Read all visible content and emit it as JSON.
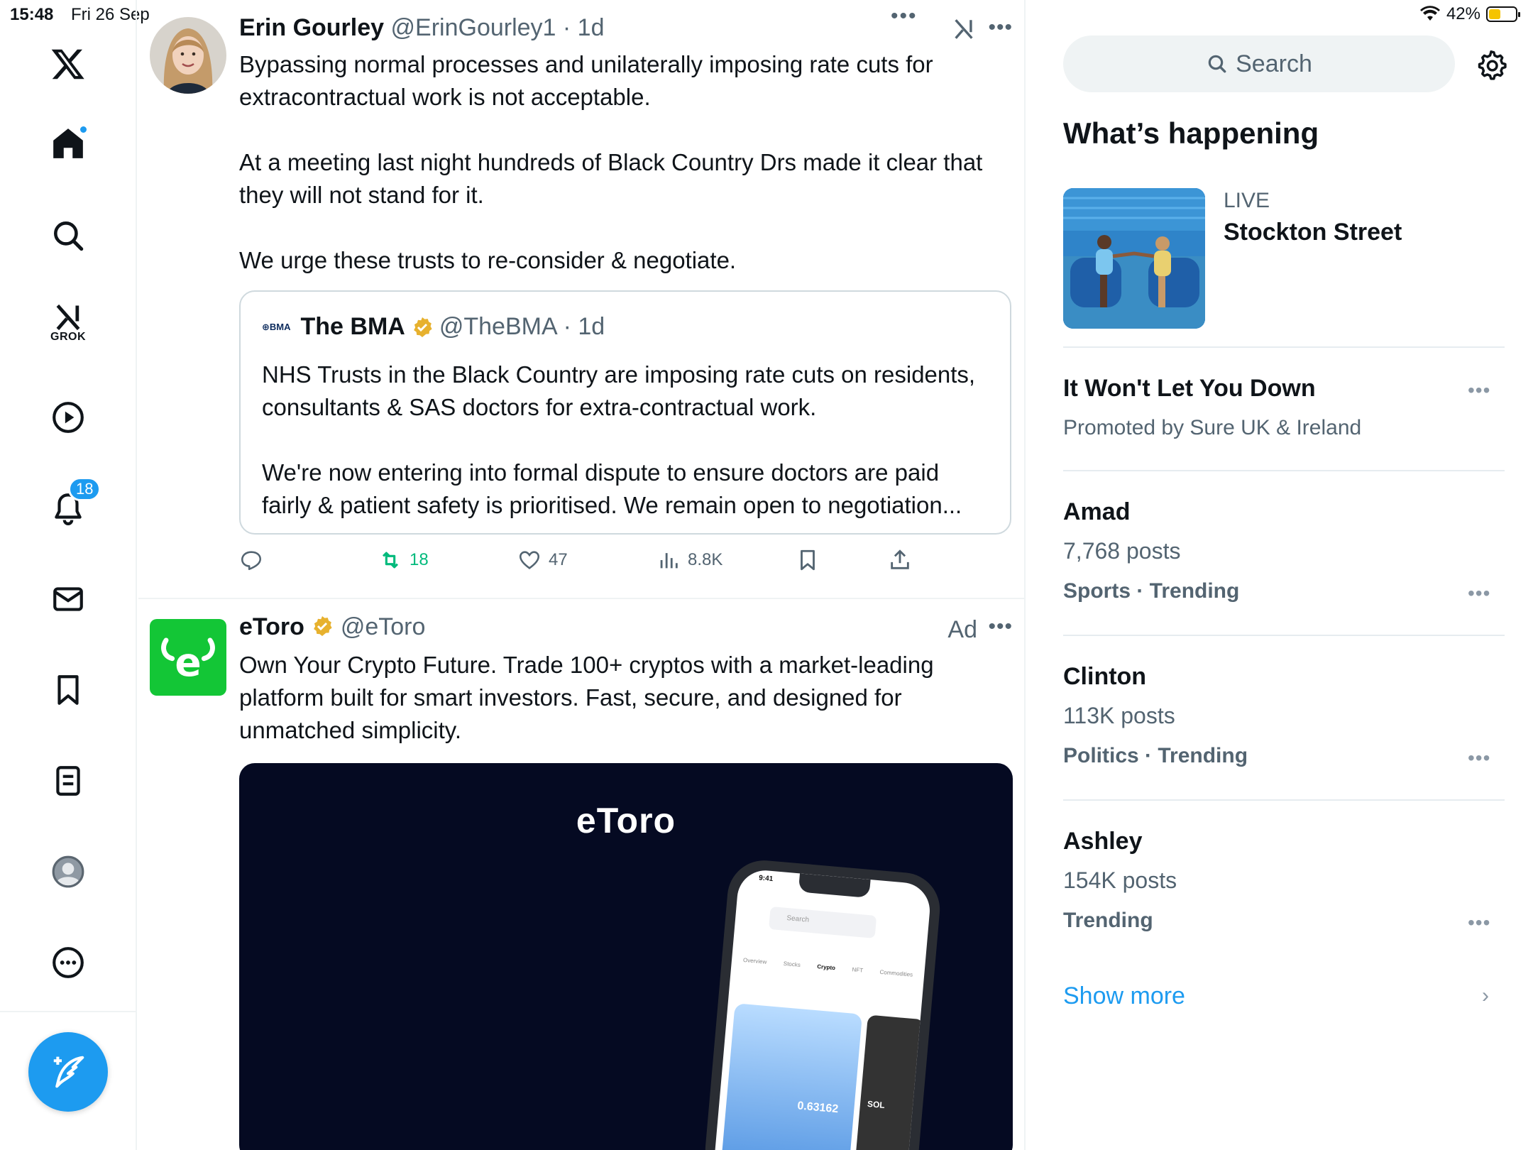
{
  "status_bar": {
    "time": "15:48",
    "date": "Fri 26 Sep",
    "battery": "42%"
  },
  "nav": {
    "grok_label": "GROK",
    "notifications_count": "18"
  },
  "feed": {
    "tweet1": {
      "name": "Erin Gourley",
      "handle": "@ErinGourley1",
      "time": "· 1d",
      "text": "Bypassing normal processes and unilaterally imposing rate cuts for extracontractual work is not acceptable.\n\nAt a meeting last night hundreds of Black Country Drs made it clear that they will not stand for it.\n\nWe urge these trusts to re-consider & negotiate.",
      "quote": {
        "logo": "BMA",
        "name": "The BMA",
        "handle": "@TheBMA",
        "time": "· 1d",
        "text": "NHS Trusts in the Black Country are imposing rate cuts on residents, consultants & SAS doctors for extra-contractual work.\n\nWe're now entering into formal dispute to ensure doctors are paid fairly & patient safety is prioritised. We remain open to negotiation..."
      },
      "actions": {
        "retweets": "18",
        "likes": "47",
        "views": "8.8K"
      }
    },
    "tweet2": {
      "name": "eToro",
      "handle": "@eToro",
      "ad_label": "Ad",
      "text": "Own Your Crypto Future. Trade 100+ cryptos with a market-leading platform built for smart investors. Fast, secure, and designed for unmatched simplicity.",
      "media": {
        "wordmark": "eToro",
        "phone_time": "9:41",
        "phone_search": "Search",
        "phone_tabs": [
          "Overview",
          "Stocks",
          "Crypto",
          "NFT",
          "Commodities"
        ],
        "phone_value": "0.63162",
        "phone_coin": "SOL"
      }
    }
  },
  "sidebar": {
    "search_placeholder": "Search",
    "section_title": "What’s happening",
    "live": {
      "label": "LIVE",
      "title": "Stockton Street"
    },
    "promoted": {
      "title": "It Won't Let You Down",
      "sub": "Promoted by Sure UK & Ireland"
    },
    "trends": [
      {
        "title": "Amad",
        "posts": "7,768 posts",
        "category": "Sports · Trending"
      },
      {
        "title": "Clinton",
        "posts": "113K posts",
        "category": "Politics · Trending"
      },
      {
        "title": "Ashley",
        "posts": "154K posts",
        "category": "Trending"
      }
    ],
    "show_more": "Show more"
  },
  "colors": {
    "accent": "#1d9bf0",
    "retweet": "#00ba7c",
    "etoro_green": "#13c636"
  }
}
